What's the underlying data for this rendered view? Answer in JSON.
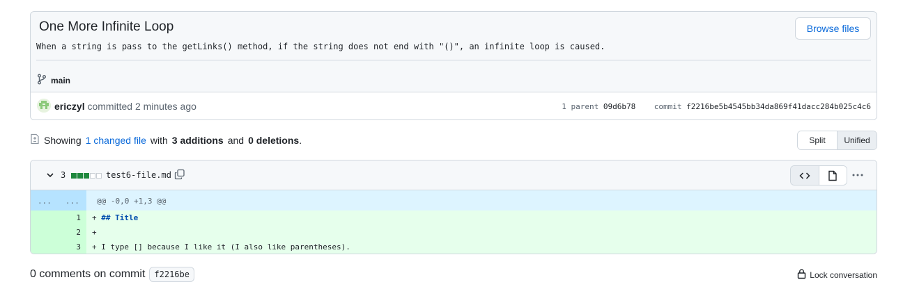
{
  "commit": {
    "title": "One More Infinite Loop",
    "description": "When a string is pass to the getLinks() method, if the string does not end with \"()\", an infinite loop is caused.",
    "browse_label": "Browse files",
    "branch": "main",
    "author": "ericzyl",
    "action": "committed 2 minutes ago",
    "parent_label": "1 parent",
    "parent_sha": "09d6b78",
    "commit_label": "commit",
    "commit_sha": "f2216be5b4545bb34da869f41dacc284b025c4c6"
  },
  "summary": {
    "prefix": "Showing",
    "changed_link": "1 changed file",
    "with": "with",
    "additions": "3 additions",
    "and": "and",
    "deletions": "0 deletions",
    "suffix": "."
  },
  "view": {
    "split_label": "Split",
    "unified_label": "Unified",
    "selected": "Unified"
  },
  "file": {
    "change_count": "3",
    "name": "test6-file.md",
    "diffstat": [
      "add",
      "add",
      "add",
      "neutral",
      "neutral"
    ],
    "hunk_left": "...",
    "hunk_right": "...",
    "hunk_header": "@@ -0,0 +1,3 @@",
    "lines": [
      {
        "num": "1",
        "prefix": "+ ",
        "text": "## Title"
      },
      {
        "num": "2",
        "prefix": "+",
        "text": ""
      },
      {
        "num": "3",
        "prefix": "+ ",
        "text": "I type [] because I like it (I also like parentheses)."
      }
    ]
  },
  "comments": {
    "label": "0 comments on commit",
    "sha": "f2216be",
    "lock_label": "Lock conversation"
  },
  "colors": {
    "link": "#0969da",
    "addition": "#1f883d",
    "added_line_bg": "#e6ffec",
    "hunk_bg": "#ddf4ff"
  },
  "icons": [
    "git-branch-icon",
    "avatar-icon",
    "file-diff-icon",
    "chevron-down-icon",
    "copy-icon",
    "code-icon",
    "file-icon",
    "kebab-horizontal-icon",
    "lock-icon"
  ]
}
